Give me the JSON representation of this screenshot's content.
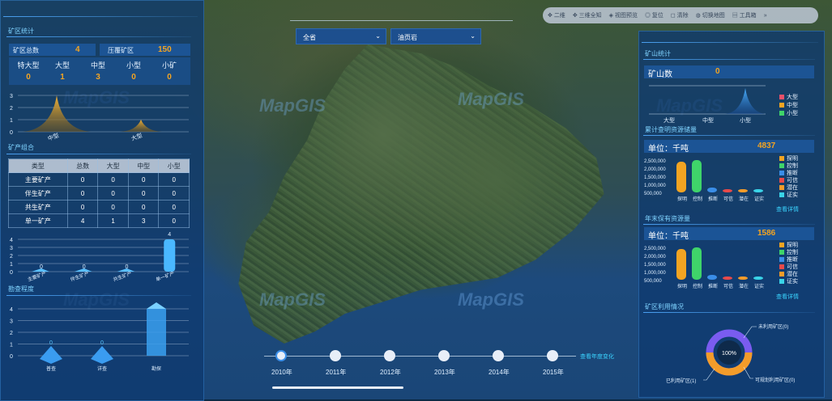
{
  "toolbar": {
    "items": [
      "二维",
      "三维全知",
      "视图预览",
      "复位",
      "清除",
      "切换地图",
      "工具箱"
    ],
    "more": "»"
  },
  "selects": {
    "region": "全省",
    "mineral": "油页岩"
  },
  "left": {
    "section1_title": "矿区统计",
    "total_label": "矿区总数",
    "total_value": "4",
    "overlap_label": "压覆矿区",
    "overlap_value": "150",
    "sizes": [
      "特大型",
      "大型",
      "中型",
      "小型",
      "小矿"
    ],
    "size_values": [
      "0",
      "1",
      "3",
      "0",
      "0"
    ],
    "area_chart": {
      "yticks": [
        "3",
        "2",
        "1",
        "0"
      ],
      "xlabels": [
        "中型",
        "大型"
      ]
    },
    "section2_title": "矿产组合",
    "table": {
      "headers": [
        "类型",
        "总数",
        "大型",
        "中型",
        "小型"
      ],
      "rows": [
        [
          "主要矿产",
          "0",
          "0",
          "0",
          "0"
        ],
        [
          "伴生矿产",
          "0",
          "0",
          "0",
          "0"
        ],
        [
          "共生矿产",
          "0",
          "0",
          "0",
          "0"
        ],
        [
          "单一矿产",
          "4",
          "1",
          "3",
          "0"
        ]
      ]
    },
    "bar_chart": {
      "yticks": [
        "4",
        "3",
        "2",
        "1",
        "0"
      ],
      "categories": [
        "主要矿产",
        "伴生矿产",
        "共生矿产",
        "单一矿产"
      ],
      "values": [
        0,
        0,
        0,
        4
      ]
    },
    "section3_title": "勘查程度",
    "pyramid_chart": {
      "yticks": [
        "4",
        "3",
        "2",
        "1",
        "0"
      ],
      "categories": [
        "普查",
        "详查",
        "勘探"
      ],
      "values": [
        0,
        0,
        4
      ]
    }
  },
  "right": {
    "section1_title": "矿山统计",
    "mine_count_label": "矿山数",
    "mine_count_value": "0",
    "mine_legend": [
      "大型",
      "中型",
      "小型"
    ],
    "mine_xlabels": [
      "大型",
      "中型",
      "小型"
    ],
    "section2_title": "累计查明资源储量",
    "unit1": "单位：千吨",
    "total1": "4837",
    "res_categories": [
      "探明",
      "控制",
      "推断",
      "可信",
      "潜在",
      "证实"
    ],
    "res_legend": [
      "探明",
      "控制",
      "推断",
      "可信",
      "潜在",
      "证实"
    ],
    "res_yticks": [
      "2,500,000",
      "2,000,000",
      "1,500,000",
      "1,000,000",
      "500,000"
    ],
    "detail_link": "查看详情",
    "section3_title": "年末保有资源量",
    "unit2": "单位：千吨",
    "total2": "1586",
    "section4_title": "矿区利用情况",
    "donut_center": "100%",
    "donut_labels": [
      "未利用矿区(0)",
      "已利用矿区(1)",
      "可规划利用矿区(0)"
    ]
  },
  "timeline": {
    "years": [
      "2010年",
      "2011年",
      "2012年",
      "2013年",
      "2014年",
      "2015年"
    ],
    "label": "查看年度变化"
  },
  "watermark": "MapGIS",
  "colors": {
    "accent": "#f3a422",
    "panel": "#0e3a70",
    "title": "#7fd3ff",
    "legend": [
      "#f3a422",
      "#3fd46a",
      "#3a8ee8",
      "#e84a4a",
      "#f39c2a",
      "#3ad4e8"
    ]
  }
}
